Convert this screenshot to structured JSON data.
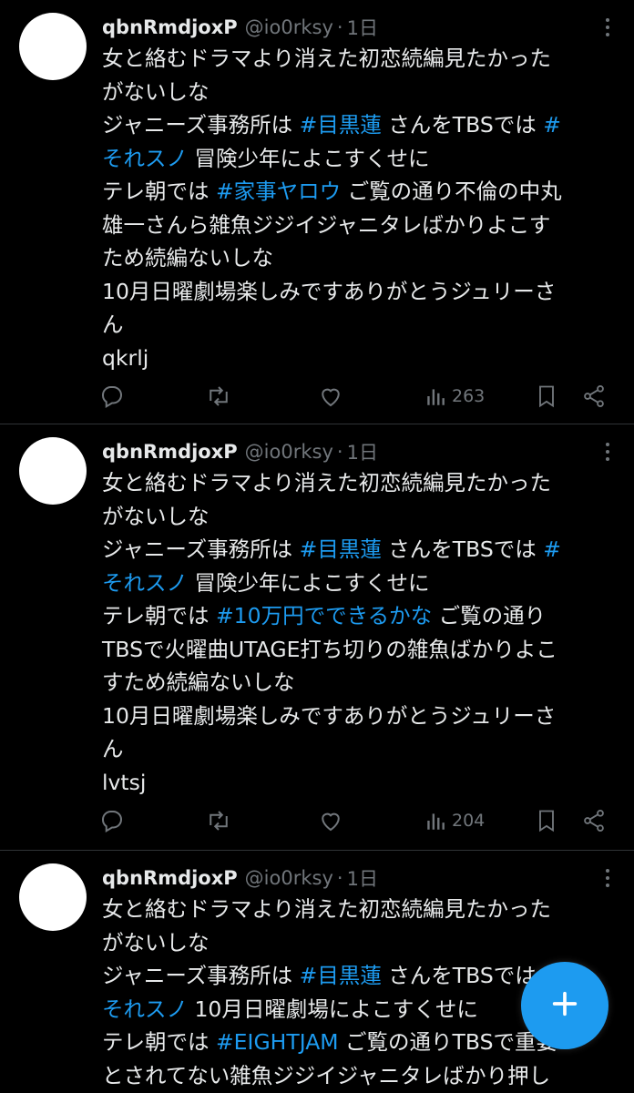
{
  "tweets": [
    {
      "author_name": "qbnRmdjoxP",
      "handle": "@io0rksy",
      "time": "1日",
      "lines": [
        [
          {
            "t": "女と絡むドラマより消えた初恋続編見たかった"
          }
        ],
        [
          {
            "t": "がないしな"
          }
        ],
        [
          {
            "t": "ジャニーズ事務所は "
          },
          {
            "t": "#目黒蓮",
            "tag": true
          },
          {
            "t": " さんをTBSでは "
          },
          {
            "t": "#",
            "tag": true
          }
        ],
        [
          {
            "t": "それスノ",
            "tag": true
          },
          {
            "t": " 冒険少年によこすくせに"
          }
        ],
        [
          {
            "t": "テレ朝では "
          },
          {
            "t": "#家事ヤロウ",
            "tag": true
          },
          {
            "t": " ご覧の通り不倫の中丸"
          }
        ],
        [
          {
            "t": "雄一さんら雑魚ジジイジャニタレばかりよこす"
          }
        ],
        [
          {
            "t": "ため続編ないしな"
          }
        ],
        [
          {
            "t": "10月日曜劇場楽しみですありがとうジュリーさ"
          }
        ],
        [
          {
            "t": "ん"
          }
        ],
        [
          {
            "t": "qkrlj"
          }
        ]
      ],
      "views": "263"
    },
    {
      "author_name": "qbnRmdjoxP",
      "handle": "@io0rksy",
      "time": "1日",
      "lines": [
        [
          {
            "t": "女と絡むドラマより消えた初恋続編見たかった"
          }
        ],
        [
          {
            "t": "がないしな"
          }
        ],
        [
          {
            "t": "ジャニーズ事務所は "
          },
          {
            "t": "#目黒蓮",
            "tag": true
          },
          {
            "t": " さんをTBSでは "
          },
          {
            "t": "#",
            "tag": true
          }
        ],
        [
          {
            "t": "それスノ",
            "tag": true
          },
          {
            "t": " 冒険少年によこすくせに"
          }
        ],
        [
          {
            "t": "テレ朝では "
          },
          {
            "t": "#10万円でできるかな",
            "tag": true
          },
          {
            "t": " ご覧の通り"
          }
        ],
        [
          {
            "t": "TBSで火曜曲UTAGE打ち切りの雑魚ばかりよこ"
          }
        ],
        [
          {
            "t": "すため続編ないしな"
          }
        ],
        [
          {
            "t": "10月日曜劇場楽しみですありがとうジュリーさ"
          }
        ],
        [
          {
            "t": "ん"
          }
        ],
        [
          {
            "t": "lvtsj"
          }
        ]
      ],
      "views": "204"
    },
    {
      "author_name": "qbnRmdjoxP",
      "handle": "@io0rksy",
      "time": "1日",
      "lines": [
        [
          {
            "t": "女と絡むドラマより消えた初恋続編見たかった"
          }
        ],
        [
          {
            "t": "がないしな"
          }
        ],
        [
          {
            "t": "ジャニーズ事務所は "
          },
          {
            "t": "#目黒蓮",
            "tag": true
          },
          {
            "t": " さんをTBSでは "
          },
          {
            "t": "#",
            "tag": true
          }
        ],
        [
          {
            "t": "それスノ",
            "tag": true
          },
          {
            "t": " 10月日曜劇場によこすくせに"
          }
        ],
        [
          {
            "t": "テレ朝では "
          },
          {
            "t": "#EIGHTJAM",
            "tag": true
          },
          {
            "t": " ご覧の通りTBSで重要"
          }
        ],
        [
          {
            "t": "とされてない雑魚ジジイジャニタレばかり押し"
          }
        ]
      ],
      "views": ""
    }
  ],
  "icons": {
    "reply": "reply-icon",
    "retweet": "retweet-icon",
    "like": "like-icon",
    "views": "views-icon",
    "bookmark": "bookmark-icon",
    "share": "share-icon",
    "compose": "plus-icon"
  },
  "colors": {
    "background": "#000000",
    "text": "#e7e9ea",
    "muted": "#71767b",
    "accent": "#1d9bf0",
    "divider": "#2f3336"
  }
}
